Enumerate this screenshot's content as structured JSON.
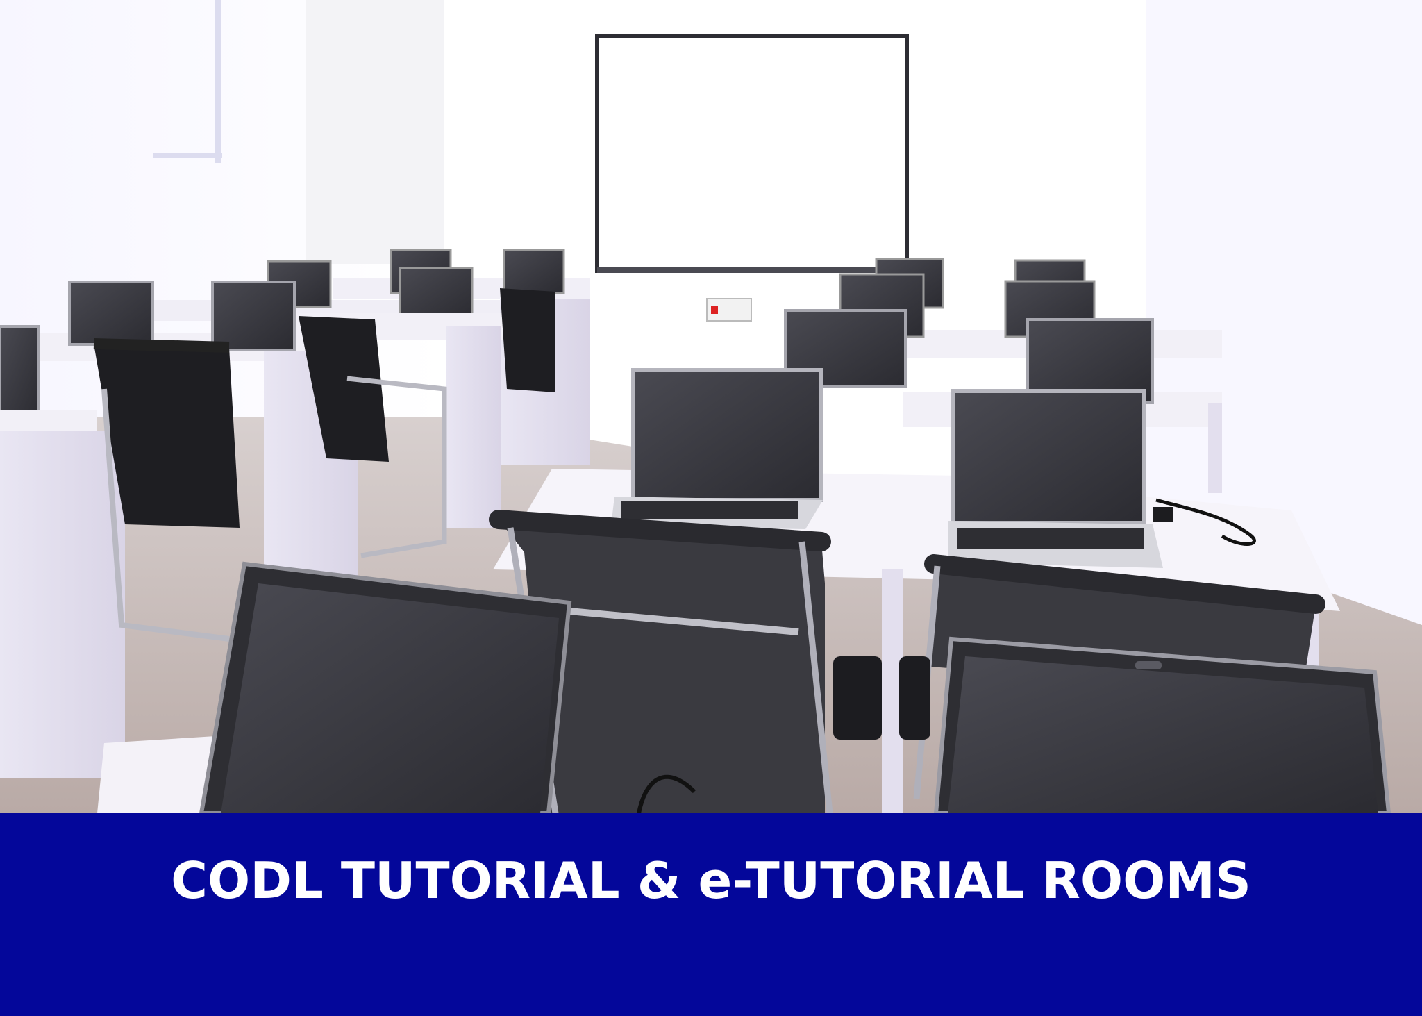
{
  "banner": {
    "title": "CODL TUTORIAL & e-TUTORIAL ROOMS",
    "background": "#04079a",
    "text_color": "#ffffff"
  },
  "photo": {
    "subject": "classroom-with-laptops"
  }
}
